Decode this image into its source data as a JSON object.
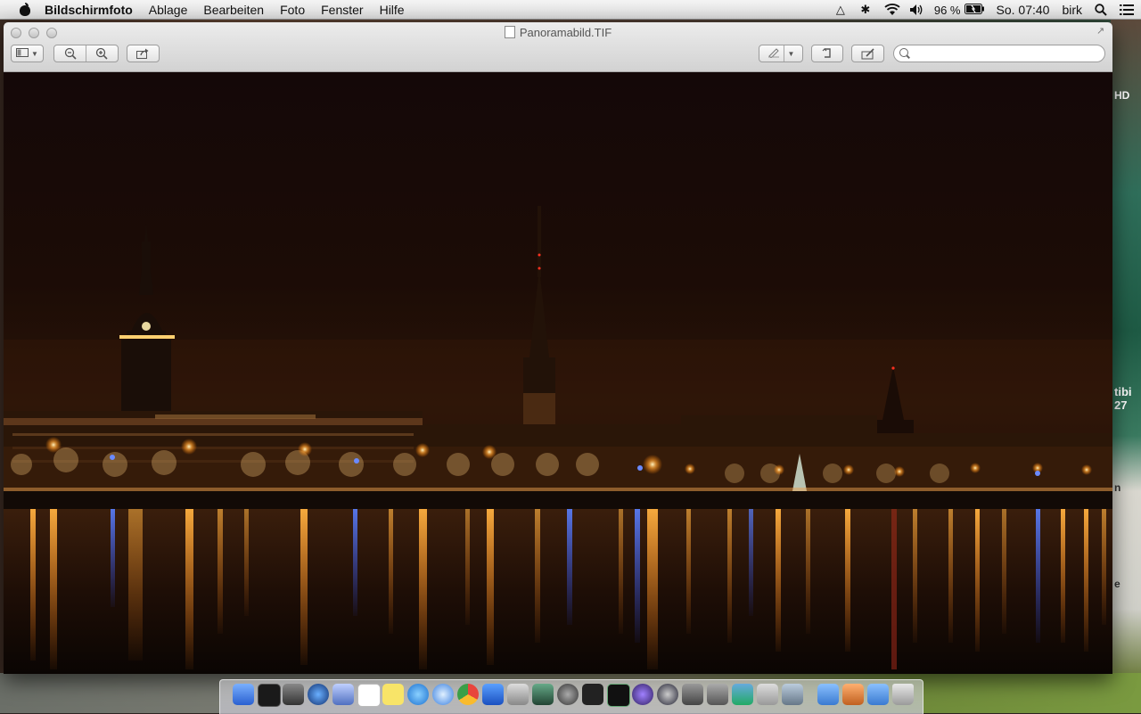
{
  "menubar": {
    "app_name": "Bildschirmfoto",
    "menus": [
      "Ablage",
      "Bearbeiten",
      "Foto",
      "Fenster",
      "Hilfe"
    ],
    "battery": "96 %",
    "clock": "So. 07:40",
    "user": "birk"
  },
  "window": {
    "title": "Panoramabild.TIF"
  },
  "search": {
    "value": "",
    "placeholder": ""
  },
  "desktop": {
    "right_texts": [
      "HD",
      "tibi 27",
      "n",
      "e"
    ]
  },
  "colors": {
    "light_glow": "#ffb84a",
    "light_warm": "#ff9a2a",
    "light_blue": "#4a7aff",
    "sky": "#150909"
  }
}
